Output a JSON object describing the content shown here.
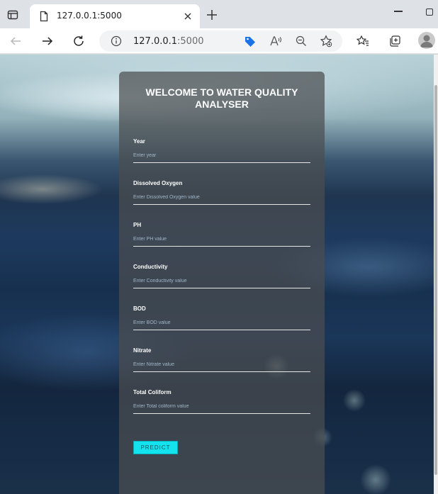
{
  "browser": {
    "tab_title": "127.0.0.1:5000",
    "address_host": "127.0.0.1",
    "address_port": ":5000"
  },
  "form": {
    "title": "WELCOME TO WATER QUALITY ANALYSER",
    "fields": [
      {
        "label": "Year",
        "placeholder": "Enter year"
      },
      {
        "label": "Dissolved Oxygen",
        "placeholder": "Enter Dissolved Oxygen value"
      },
      {
        "label": "PH",
        "placeholder": "Enter PH value"
      },
      {
        "label": "Conductivity",
        "placeholder": "Enter Conductivity value"
      },
      {
        "label": "BOD",
        "placeholder": "Enter BOD value"
      },
      {
        "label": "Nitrate",
        "placeholder": "Enter Nitrate value"
      },
      {
        "label": "Total Coliform",
        "placeholder": "Enter Total coliform value"
      }
    ],
    "submit_label": "PREDICT"
  },
  "colors": {
    "accent": "#12e3ee",
    "card_bg": "#4b4e50"
  }
}
